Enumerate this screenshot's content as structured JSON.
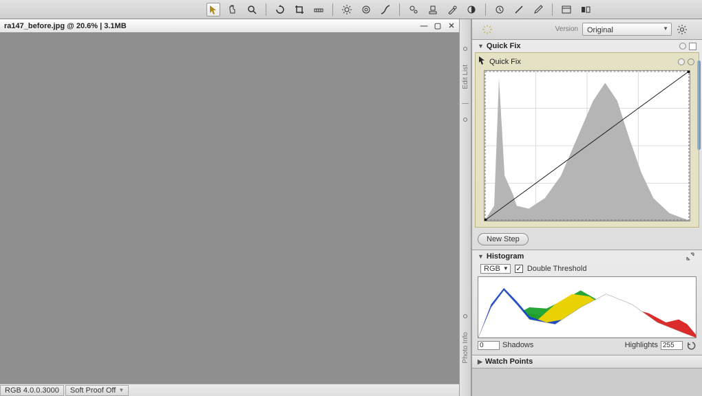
{
  "toolbar": {
    "icons": [
      "pointer",
      "hand",
      "zoom",
      "rotate",
      "crop",
      "straighten",
      "sun",
      "target",
      "curves",
      "auto",
      "stamp",
      "brush",
      "color",
      "clock",
      "line",
      "eyedropper",
      "window",
      "compare"
    ]
  },
  "document": {
    "title": "ra147_before.jpg @ 20.6% | 3.1MB"
  },
  "side_tabs": {
    "tab1": "Edit List",
    "tab2": "Photo Info"
  },
  "version_bar": {
    "label": "Version",
    "selected": "Original"
  },
  "quick_fix": {
    "panel_title": "Quick Fix",
    "step_title": "Quick Fix",
    "new_step": "New Step"
  },
  "histogram": {
    "title": "Histogram",
    "channel": "RGB",
    "double_threshold": "Double Threshold",
    "shadows_label": "Shadows",
    "highlights_label": "Highlights",
    "shadows_value": "0",
    "highlights_value": "255"
  },
  "watch_points": {
    "title": "Watch Points"
  },
  "status": {
    "rgb": "RGB 4.0.0.3000",
    "soft_proof": "Soft Proof Off"
  },
  "chart_data": [
    {
      "type": "area",
      "title": "Curves histogram",
      "xlabel": "",
      "ylabel": "",
      "xlim": [
        0,
        255
      ],
      "ylim": [
        0,
        1
      ],
      "series": [
        {
          "name": "Luminance",
          "x": [
            0,
            12,
            18,
            25,
            35,
            40,
            55,
            75,
            95,
            115,
            135,
            150,
            165,
            180,
            195,
            210,
            230,
            255
          ],
          "values": [
            0.0,
            0.1,
            0.95,
            0.3,
            0.18,
            0.1,
            0.08,
            0.15,
            0.3,
            0.55,
            0.8,
            0.92,
            0.8,
            0.55,
            0.32,
            0.15,
            0.05,
            0.0
          ]
        }
      ],
      "curve": {
        "points": [
          [
            0,
            0
          ],
          [
            255,
            255
          ]
        ]
      }
    },
    {
      "type": "area",
      "title": "RGB histogram",
      "xlabel": "",
      "ylabel": "",
      "xlim": [
        0,
        255
      ],
      "ylim": [
        0,
        1
      ],
      "series": [
        {
          "name": "Red",
          "color": "#d92020",
          "x": [
            0,
            20,
            40,
            60,
            80,
            110,
            140,
            170,
            200,
            220,
            235,
            245,
            255
          ],
          "values": [
            0.0,
            0.15,
            0.3,
            0.4,
            0.35,
            0.3,
            0.38,
            0.52,
            0.4,
            0.25,
            0.3,
            0.22,
            0.05
          ]
        },
        {
          "name": "Green",
          "color": "#19a22c",
          "x": [
            0,
            20,
            40,
            60,
            80,
            100,
            120,
            140,
            160,
            180,
            210,
            255
          ],
          "values": [
            0.0,
            0.2,
            0.35,
            0.5,
            0.48,
            0.62,
            0.78,
            0.62,
            0.42,
            0.25,
            0.08,
            0.0
          ]
        },
        {
          "name": "Blue",
          "color": "#1544cc",
          "x": [
            0,
            15,
            30,
            45,
            60,
            80,
            100,
            120,
            150,
            180,
            210,
            255
          ],
          "values": [
            0.0,
            0.55,
            0.82,
            0.6,
            0.35,
            0.25,
            0.3,
            0.45,
            0.7,
            0.55,
            0.15,
            0.0
          ]
        },
        {
          "name": "Yellow",
          "color": "#f2d400",
          "x": [
            0,
            40,
            70,
            90,
            110,
            130,
            150,
            180,
            210,
            255
          ],
          "values": [
            0.0,
            0.1,
            0.3,
            0.55,
            0.72,
            0.68,
            0.5,
            0.22,
            0.05,
            0.0
          ]
        },
        {
          "name": "Luminance",
          "color": "#ffffff",
          "x": [
            0,
            15,
            30,
            45,
            60,
            90,
            120,
            150,
            180,
            210,
            240,
            255
          ],
          "values": [
            0.0,
            0.5,
            0.78,
            0.55,
            0.3,
            0.22,
            0.5,
            0.72,
            0.55,
            0.25,
            0.08,
            0.0
          ]
        }
      ]
    }
  ]
}
